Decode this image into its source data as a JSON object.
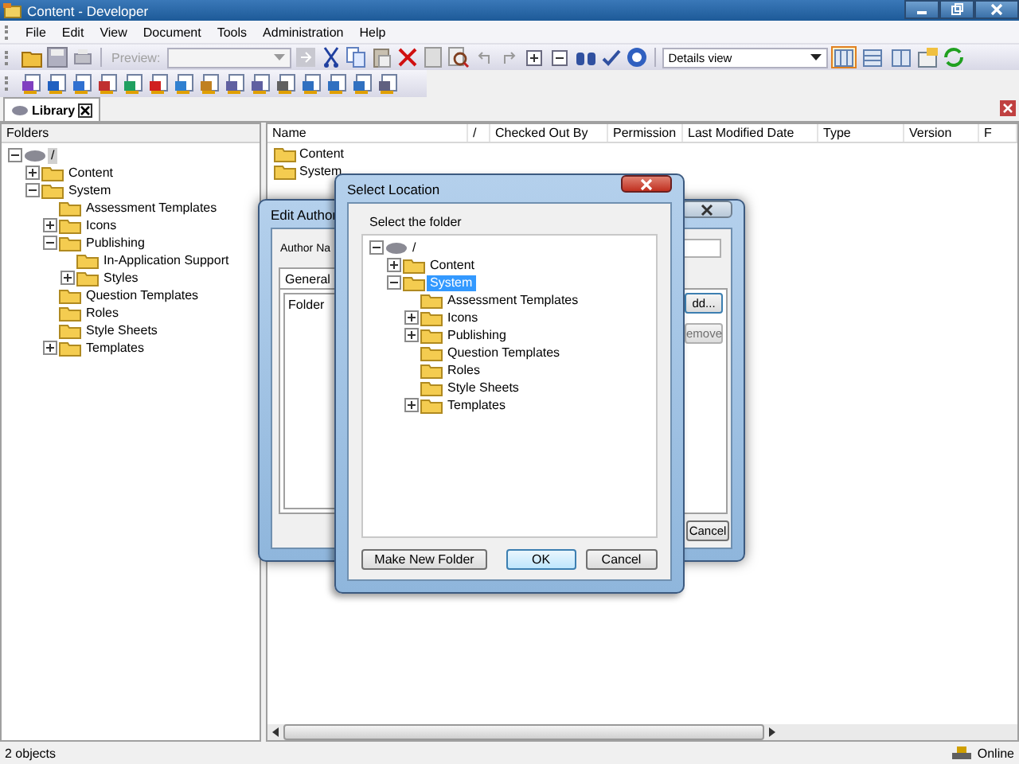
{
  "window": {
    "title": "Content - Developer"
  },
  "menu": [
    "File",
    "Edit",
    "View",
    "Document",
    "Tools",
    "Administration",
    "Help"
  ],
  "toolbar": {
    "preview_label": {
      "text": "Preview:",
      "disabled": true
    },
    "view_select": {
      "value": "Details view"
    },
    "view_buttons": [
      {
        "selected": true
      },
      {
        "selected": false
      },
      {
        "selected": false
      }
    ]
  },
  "tabs": [
    {
      "label": "Library",
      "selected": true
    }
  ],
  "folders": {
    "title": "Folders",
    "tree": [
      {
        "label": "/",
        "selected": true,
        "expanded": true,
        "children": [
          {
            "label": "Content",
            "selected": false,
            "expanded": false
          },
          {
            "label": "System",
            "selected": false,
            "expanded": true,
            "children": [
              {
                "label": "Assessment Templates",
                "selected": false
              },
              {
                "label": "Icons",
                "selected": false,
                "expanded": false
              },
              {
                "label": "Publishing",
                "selected": false,
                "expanded": true,
                "children": [
                  {
                    "label": "In-Application Support",
                    "selected": false
                  },
                  {
                    "label": "Styles",
                    "selected": false,
                    "expanded": false
                  }
                ]
              },
              {
                "label": "Question Templates",
                "selected": false
              },
              {
                "label": "Roles",
                "selected": false
              },
              {
                "label": "Style Sheets",
                "selected": false
              },
              {
                "label": "Templates",
                "selected": false,
                "expanded": false
              }
            ]
          }
        ]
      }
    ]
  },
  "table": {
    "columns": [
      "Name",
      "/",
      "Checked Out By",
      "Permission",
      "Last Modified Date",
      "Type",
      "Version",
      "F"
    ],
    "rows": [
      {
        "name": "Content"
      },
      {
        "name": "System"
      }
    ]
  },
  "edit_author_dialog": {
    "title": "Edit Author",
    "author_label": "Author Na",
    "tabs": [
      {
        "label": "General",
        "selected": true
      }
    ],
    "list_header": "Folder",
    "buttons": [
      "dd...",
      "emove",
      "Cancel"
    ]
  },
  "select_location_dialog": {
    "title": "Select Location",
    "prompt": "Select the folder",
    "tree": [
      {
        "label": "/",
        "selected": false,
        "expanded": true,
        "children": [
          {
            "label": "Content",
            "selected": false,
            "expanded": false
          },
          {
            "label": "System",
            "selected": true,
            "expanded": true,
            "children": [
              {
                "label": "Assessment Templates",
                "selected": false
              },
              {
                "label": "Icons",
                "selected": false,
                "expanded": false
              },
              {
                "label": "Publishing",
                "selected": false,
                "expanded": false
              },
              {
                "label": "Question Templates",
                "selected": false
              },
              {
                "label": "Roles",
                "selected": false
              },
              {
                "label": "Style Sheets",
                "selected": false
              },
              {
                "label": "Templates",
                "selected": false,
                "expanded": false
              }
            ]
          }
        ]
      }
    ],
    "buttons": [
      "Make New Folder",
      "OK",
      "Cancel"
    ]
  },
  "status_bar": {
    "text": "2 objects",
    "connection": "Online"
  }
}
